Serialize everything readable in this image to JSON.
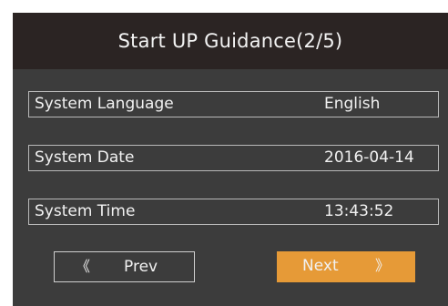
{
  "dialog": {
    "title": "Start UP Guidance(2/5)",
    "rows": [
      {
        "label": "System Language",
        "value": "English"
      },
      {
        "label": "System Date",
        "value": "2016-04-14"
      },
      {
        "label": "System Time",
        "value": "13:43:52"
      }
    ],
    "prev": {
      "icon": "double-chevron-left-icon",
      "glyph": "《",
      "label": "Prev"
    },
    "next": {
      "icon": "double-chevron-right-icon",
      "glyph": "》",
      "label": "Next"
    }
  },
  "colors": {
    "page_bg": "#ffffff",
    "dialog_bg": "#3c3c3c",
    "title_bar_bg": "#2b2423",
    "accent": "#e69a37",
    "text": "#f1f1f1",
    "row_border": "#b9b9b9"
  }
}
